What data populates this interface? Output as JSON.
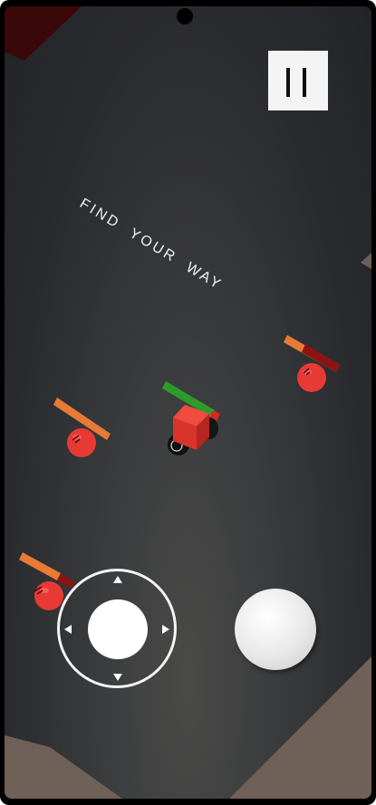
{
  "screen": {
    "hint_text": "FIND  YOUR  WAY"
  },
  "controls": {
    "pause_icon": "pause-icon",
    "joystick_arrows": [
      "arrow-up-icon",
      "arrow-down-icon",
      "arrow-left-icon",
      "arrow-right-icon"
    ],
    "action_button_icon": "circle-button"
  },
  "colors": {
    "background": "#2c2d30",
    "player_body": "#e53a30",
    "player_health": "#2e9b2a",
    "enemy_body": "#e83a35",
    "enemy_health": "#e87a36",
    "enemy_health_dark": "#8b1512",
    "ground_corner": "#6e5e57",
    "ui_white": "#f4f4f4"
  }
}
